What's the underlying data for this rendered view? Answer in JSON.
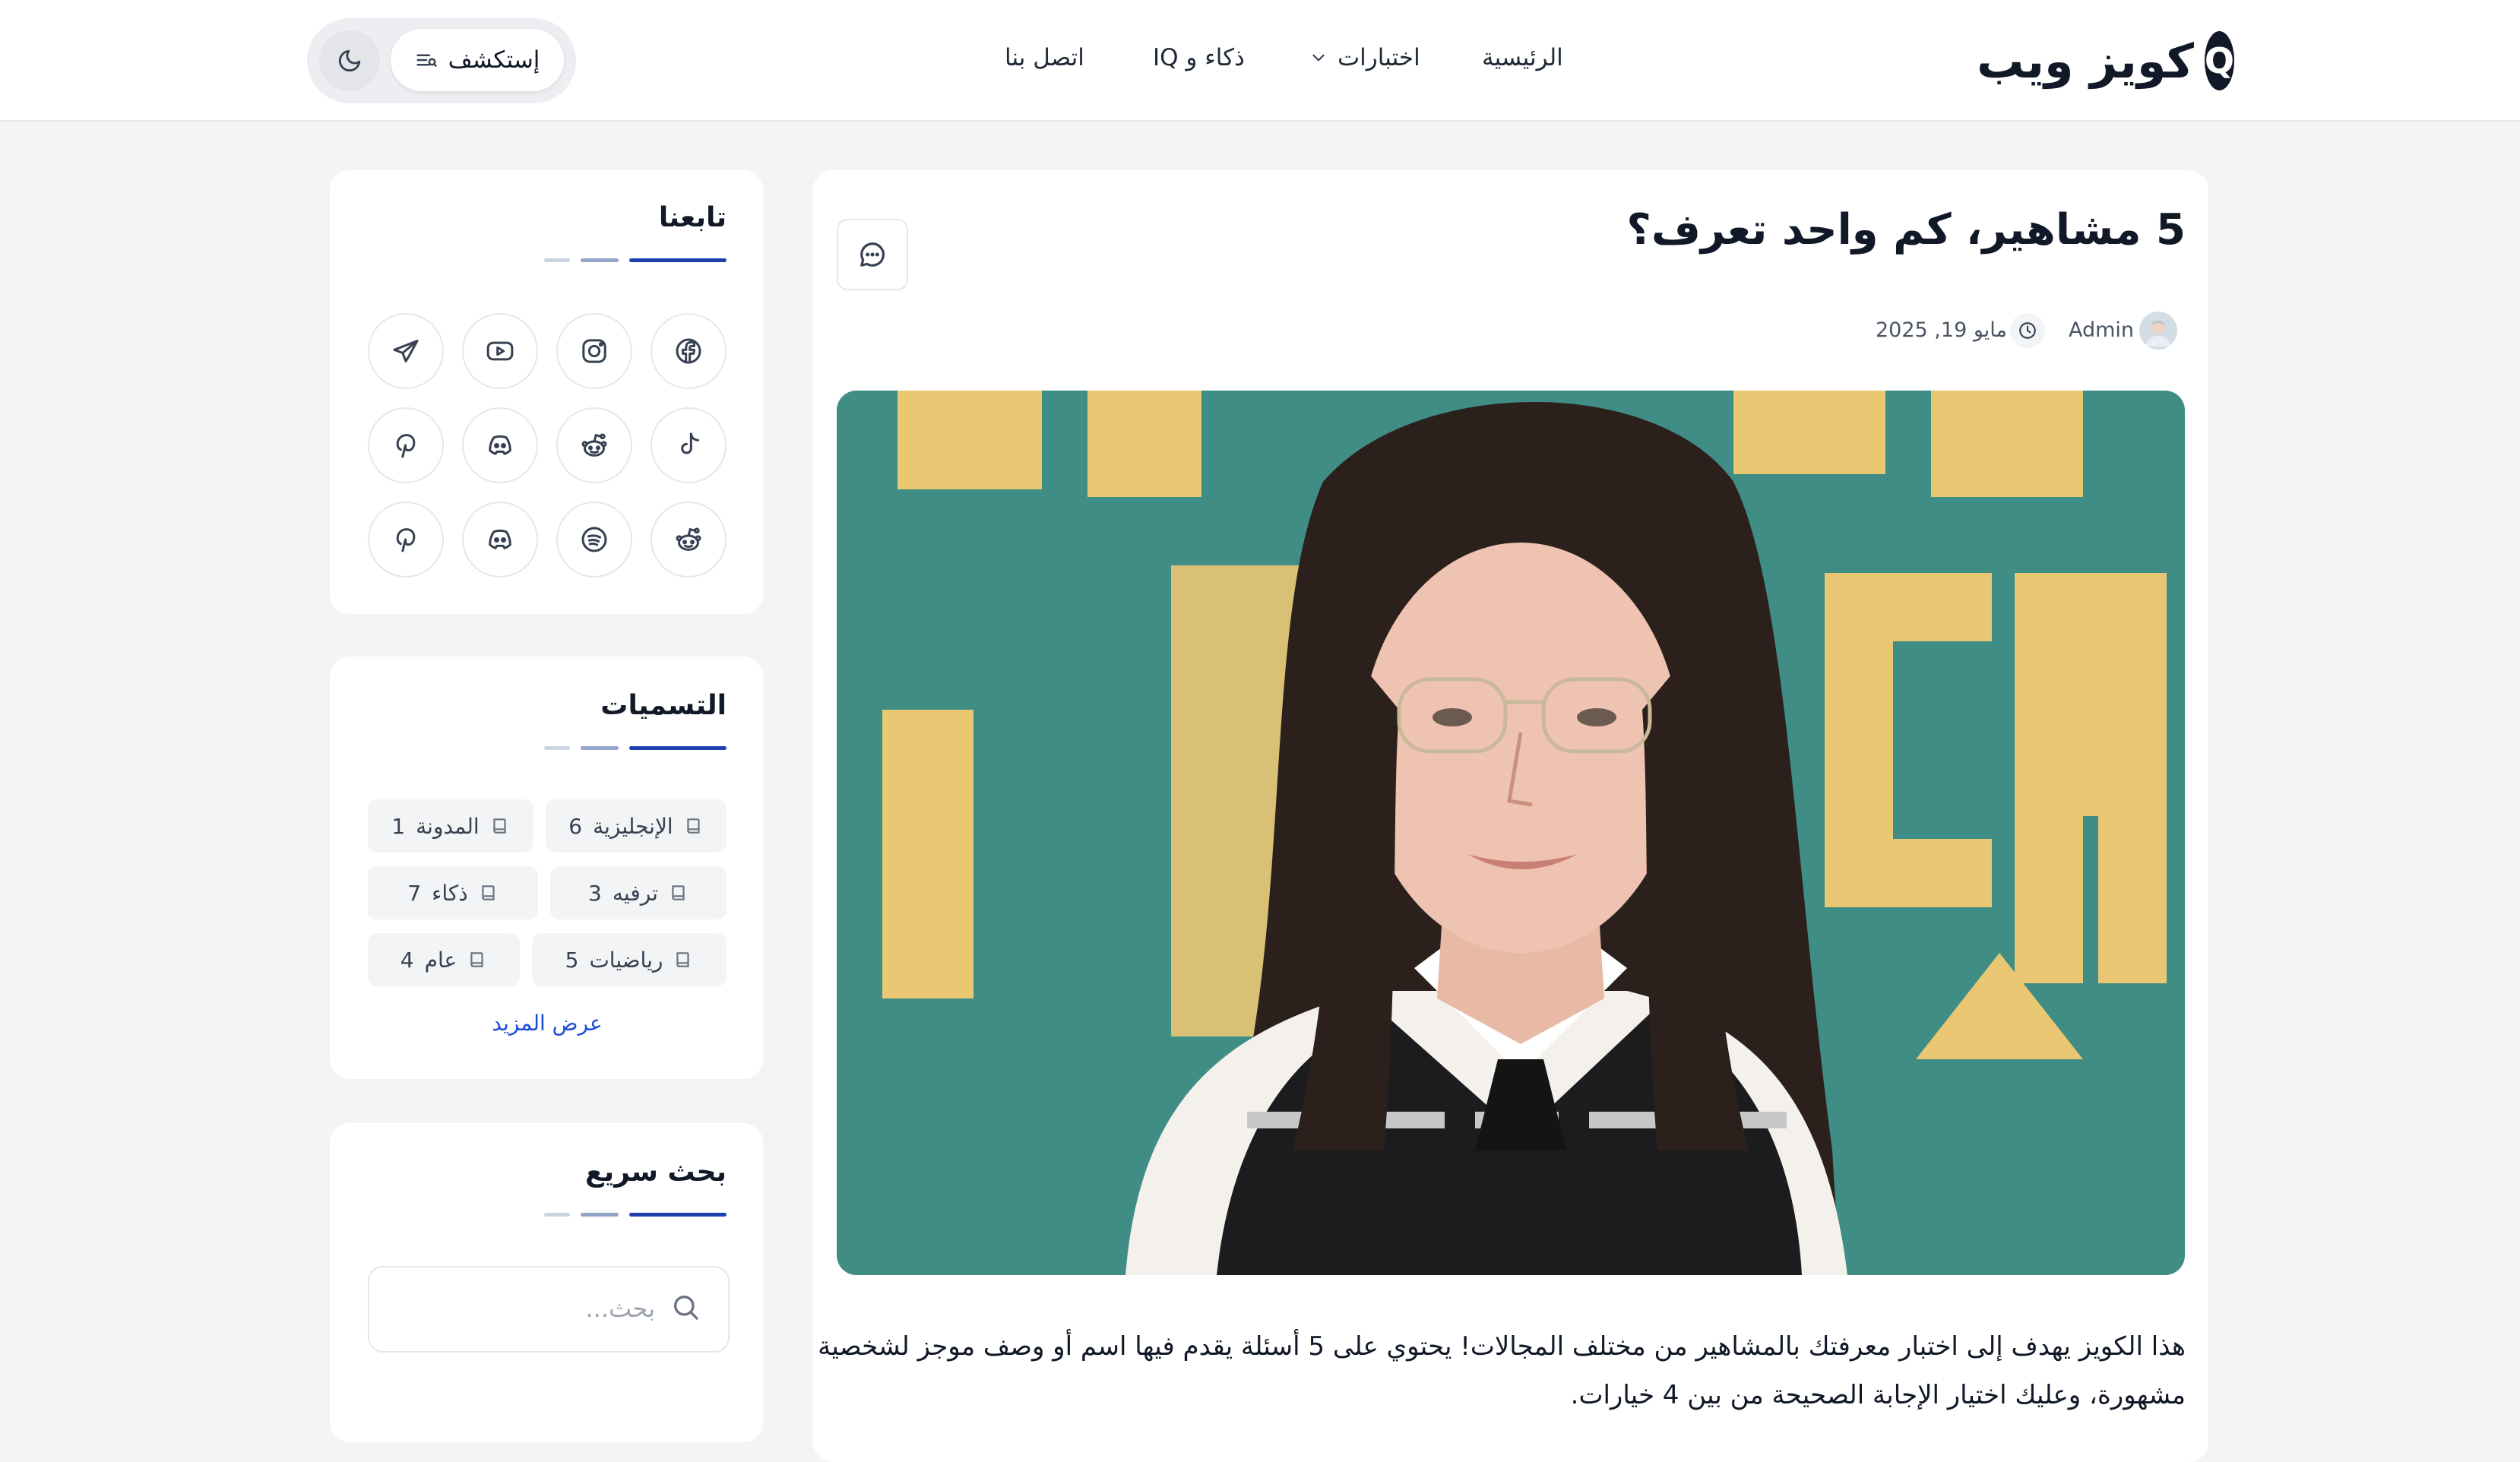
{
  "header": {
    "logo_letter": "Q",
    "logo_text": "كويز ويب",
    "nav": [
      {
        "label": "الرئيسية"
      },
      {
        "label": "اختبارات"
      },
      {
        "label": "ذكاء و IQ"
      },
      {
        "label": "اتصل بنا"
      }
    ],
    "explore_label": "إستكشف"
  },
  "article": {
    "title": "5 مشاهير، كم واحد تعرف؟",
    "author": "Admin",
    "date": "مايو 19, 2025",
    "body_lines": [
      "هذا الكويز يهدف إلى اختبار معرفتك بالمشاهير من مختلف المجالات! يحتوي على 5 أسئلة يقدم فيها اسم أو وصف موجز لشخصية",
      "مشهورة، وعليك اختيار الإجابة الصحيحة من بين 4 خيارات."
    ]
  },
  "sidebar": {
    "follow": {
      "title": "تابعنا",
      "icons": [
        "facebook-icon",
        "instagram-icon",
        "youtube-icon",
        "telegram-icon",
        "tiktok-icon",
        "reddit-icon",
        "discord-icon",
        "pinterest-icon",
        "reddit-icon",
        "spotify-icon",
        "discord-icon",
        "pinterest-icon"
      ]
    },
    "tags": {
      "title": "التسميات",
      "items": [
        {
          "name": "الإنجليزية",
          "count": "6"
        },
        {
          "name": "المدونة",
          "count": "1"
        },
        {
          "name": "ترفيه",
          "count": "3"
        },
        {
          "name": "ذكاء",
          "count": "7"
        },
        {
          "name": "رياضيات",
          "count": "5"
        },
        {
          "name": "عام",
          "count": "4"
        }
      ],
      "show_more": "عرض المزيد"
    },
    "search": {
      "title": "بحث سريع",
      "placeholder": "بحث..."
    }
  },
  "colors": {
    "accent": "#1e40af",
    "rule_light": "#93a5c8",
    "rule_gray": "#cbd5e1",
    "background": "#f3f4f6"
  }
}
